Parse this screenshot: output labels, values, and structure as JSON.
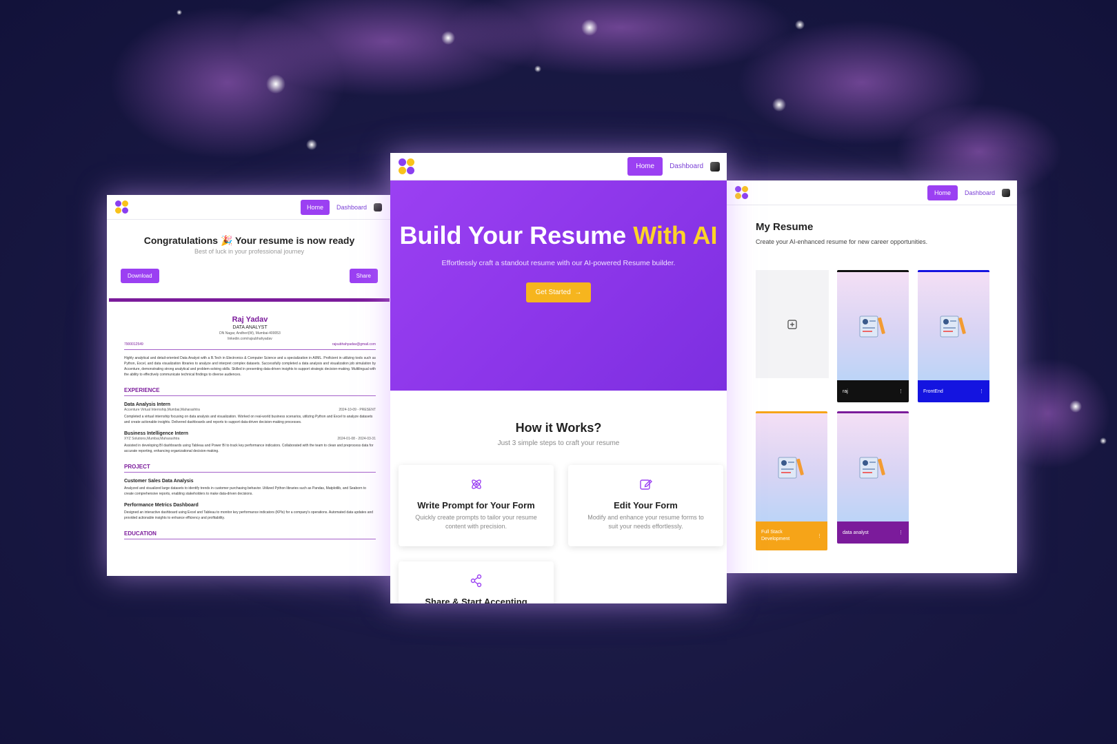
{
  "colors": {
    "accent": "#9b40f2",
    "resume_purple": "#7b1b9b",
    "hero_yellow": "#fdd329",
    "button_yellow": "#f6b51e"
  },
  "shared_nav": {
    "home_label": "Home",
    "dashboard_label": "Dashboard"
  },
  "left_panel": {
    "congrats_title": "Congratulations 🎉 Your resume is now ready",
    "congrats_subtitle": "Best of luck in your professional journey",
    "download_label": "Download",
    "share_label": "Share",
    "resume": {
      "name": "Raj Yadav",
      "role": "DATA ANALYST",
      "address": "DN Nagar, Andheri(W), Mumbai-400053",
      "linkedin": "linkedin.com/rajsubhahyadav",
      "phone": "7900012549",
      "email": "rajsubhahyadav@gmail.com",
      "summary": "Highly analytical and detail-oriented Data Analyst with a B.Tech in Electronics & Computer Science and a specialization in AI/ML. Proficient in utilizing tools such as Python, Excel, and data visualization libraries to analyze and interpret complex datasets. Successfully completed a data analysis and visualization job simulation by Accenture, demonstrating strong analytical and problem-solving skills. Skilled in presenting data-driven insights to support strategic decision-making. Multilingual with the ability to effectively communicate technical findings to diverse audiences.",
      "experience_heading": "EXPERIENCE",
      "experience": [
        {
          "title": "Data Analysis Intern",
          "company": "Accenture Virtual Internship,Mumbai,Maharashtra",
          "dates": "2024-10-09 - PRESENT",
          "desc": "Completed a virtual internship focusing on data analysis and visualization. Worked on real-world business scenarios, utilizing Python and Excel to analyze datasets and create actionable insights. Delivered dashboards and reports to support data-driven decision-making processes."
        },
        {
          "title": "Business Intelligence Intern",
          "company": "XYZ Solutions,Mumbai,Maharashtra",
          "dates": "2024-01-08 - 2024-03-31",
          "desc": "Assisted in developing BI dashboards using Tableau and Power BI to track key performance indicators. Collaborated with the team to clean and preprocess data for accurate reporting, enhancing organizational decision-making."
        }
      ],
      "project_heading": "PROJECT",
      "projects": [
        {
          "title": "Customer Sales Data Analysis",
          "desc": "Analyzed and visualized large datasets to identify trends in customer purchasing behavior. Utilized Python libraries such as Pandas, Matplotlib, and Seaborn to create comprehensive reports, enabling stakeholders to make data-driven decisions."
        },
        {
          "title": "Performance Metrics Dashboard",
          "desc": "Designed an interactive dashboard using Excel and Tableau to monitor key performance indicators (KPIs) for a company's operations. Automated data updates and provided actionable insights to enhance efficiency and profitability."
        }
      ],
      "education_heading": "EDUCATION"
    }
  },
  "mid_panel": {
    "hero_title_main": "Build Your Resume ",
    "hero_title_accent": "With AI",
    "hero_subtitle": "Effortlessly craft a standout resume with our AI-powered Resume builder.",
    "get_started_label": "Get Started",
    "how_title": "How it Works?",
    "how_subtitle": "Just 3 simple steps to craft your resume",
    "steps": [
      {
        "title": "Write Prompt for Your Form",
        "desc": "Quickly create prompts to tailor your resume content with precision.",
        "icon": "atom-icon"
      },
      {
        "title": "Edit Your Form",
        "desc": "Modify and enhance your resume forms to suit your needs effortlessly.",
        "icon": "edit-icon"
      },
      {
        "title": "Share & Start Accepting",
        "desc": "",
        "icon": "share-icon"
      }
    ]
  },
  "right_panel": {
    "title": "My Resume",
    "subtitle": "Create your AI-enhanced resume for new career opportunities.",
    "resumes": [
      {
        "name": "raj",
        "color": "#111111"
      },
      {
        "name": "FrontEnd",
        "color": "#1414e0"
      },
      {
        "name": "Full Stack Development",
        "color": "#f6a418"
      },
      {
        "name": "data analyst",
        "color": "#7b1b9b"
      }
    ]
  }
}
